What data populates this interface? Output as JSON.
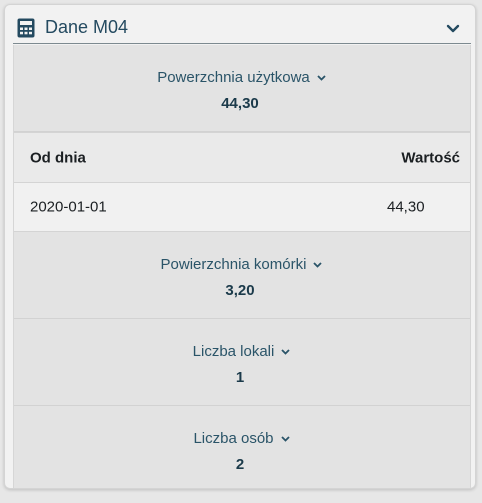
{
  "panel": {
    "title": "Dane M04",
    "accent": "#244a60",
    "icon": "calculator-icon",
    "collapse_icon": "chevron-down-icon"
  },
  "metrics": [
    {
      "label": "Powerzchnia użytkowa",
      "value": "44,30"
    },
    {
      "label": "Powierzchnia komórki",
      "value": "3,20"
    },
    {
      "label": "Liczba lokali",
      "value": "1"
    },
    {
      "label": "Liczba osób",
      "value": "2"
    }
  ],
  "history_table": {
    "columns": [
      "Od dnia",
      "Wartość"
    ],
    "rows": [
      [
        "2020-01-01",
        "44,30"
      ]
    ]
  }
}
